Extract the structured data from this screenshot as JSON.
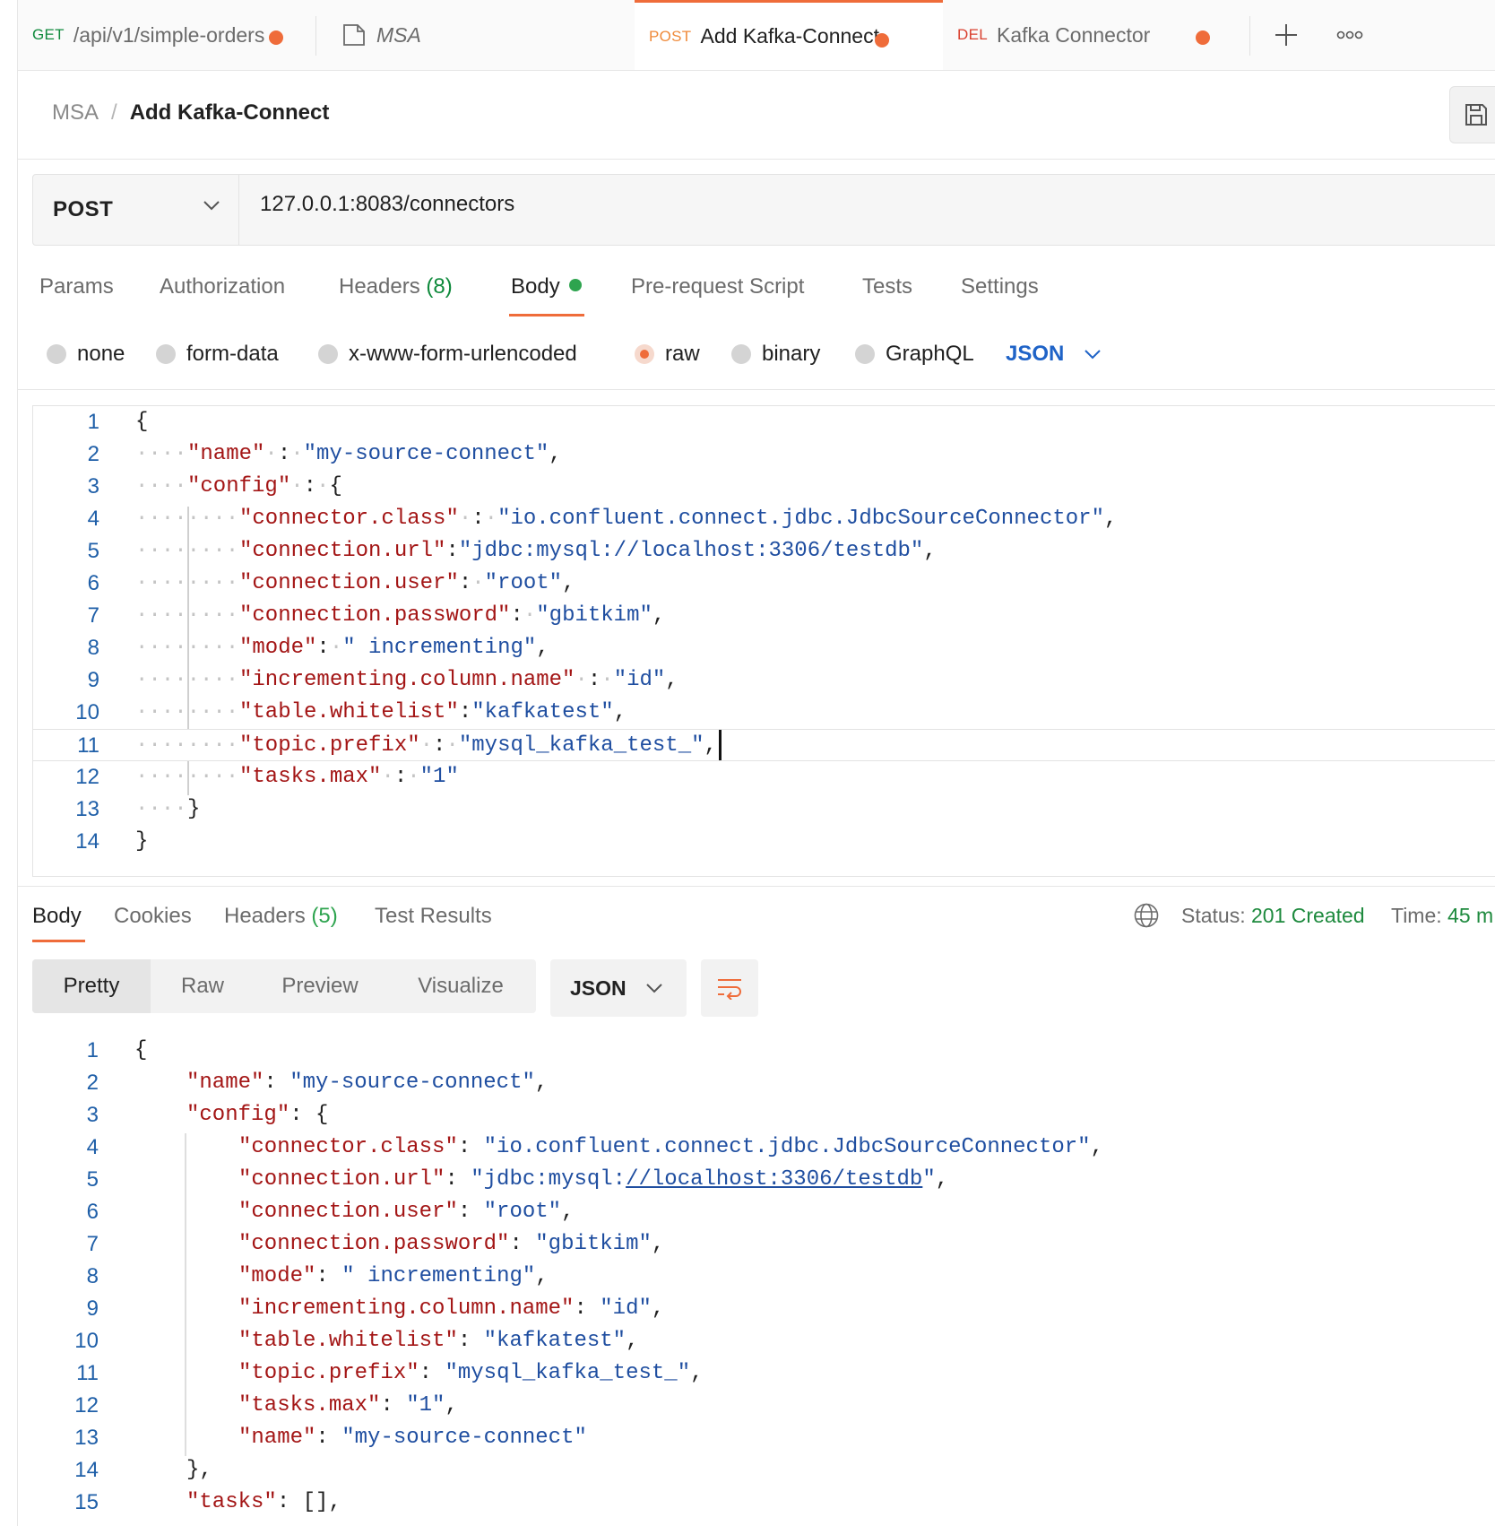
{
  "tabs": [
    {
      "method": "GET",
      "title": "/api/v1/simple-orders"
    },
    {
      "title": "MSA"
    },
    {
      "method": "POST",
      "title": "Add Kafka-Connect"
    },
    {
      "method": "DEL",
      "title": "Kafka Connector"
    }
  ],
  "breadcrumb": {
    "parent": "MSA",
    "separator": "/",
    "current": "Add Kafka-Connect"
  },
  "request": {
    "method": "POST",
    "url": "127.0.0.1:8083/connectors",
    "tabs": {
      "params": "Params",
      "authorization": "Authorization",
      "headers": "Headers",
      "headers_count": "(8)",
      "body": "Body",
      "prerequest": "Pre-request Script",
      "tests": "Tests",
      "settings": "Settings"
    },
    "body_types": [
      "none",
      "form-data",
      "x-www-form-urlencoded",
      "raw",
      "binary",
      "GraphQL"
    ],
    "selected_body_type": "raw",
    "raw_format": "JSON"
  },
  "response": {
    "tabs": {
      "body": "Body",
      "cookies": "Cookies",
      "headers": "Headers",
      "headers_count": "(5)",
      "test_results": "Test Results"
    },
    "status_label": "Status:",
    "status_value": "201 Created",
    "time_label": "Time:",
    "time_value": "45 m",
    "views": [
      "Pretty",
      "Raw",
      "Preview",
      "Visualize"
    ],
    "selected_view": "Pretty",
    "format": "JSON"
  },
  "colors": {
    "accent": "#ef6c3a",
    "get": "#0f8a3c",
    "delete": "#d9402f",
    "link": "#1f63c7",
    "success": "#1e8a3e",
    "json_key": "#a31515",
    "json_string": "#1f4ea0"
  },
  "request_body_lines": [
    {
      "n": "1",
      "text": "{"
    },
    {
      "n": "2",
      "text": "\"name\" : \"my-source-connect\","
    },
    {
      "n": "3",
      "text": "\"config\" : {"
    },
    {
      "n": "4",
      "text": "\"connector.class\" : \"io.confluent.connect.jdbc.JdbcSourceConnector\","
    },
    {
      "n": "5",
      "text": "\"connection.url\":\"jdbc:mysql://localhost:3306/testdb\","
    },
    {
      "n": "6",
      "text": "\"connection.user\": \"root\","
    },
    {
      "n": "7",
      "text": "\"connection.password\": \"gbitkim\","
    },
    {
      "n": "8",
      "text": "\"mode\": \" incrementing\","
    },
    {
      "n": "9",
      "text": "\"incrementing.column.name\" : \"id\","
    },
    {
      "n": "10",
      "text": "\"table.whitelist\":\"kafkatest\","
    },
    {
      "n": "11",
      "text": "\"topic.prefix\" : \"mysql_kafka_test_\","
    },
    {
      "n": "12",
      "text": "\"tasks.max\" : \"1\""
    },
    {
      "n": "13",
      "text": "}"
    },
    {
      "n": "14",
      "text": "}"
    }
  ],
  "response_body_lines": [
    {
      "n": "1",
      "text": "{"
    },
    {
      "n": "2",
      "text": "\"name\": \"my-source-connect\","
    },
    {
      "n": "3",
      "text": "\"config\": {"
    },
    {
      "n": "4",
      "text": "\"connector.class\": \"io.confluent.connect.jdbc.JdbcSourceConnector\","
    },
    {
      "n": "5",
      "text": "\"connection.url\": \"jdbc:mysql://localhost:3306/testdb\","
    },
    {
      "n": "6",
      "text": "\"connection.user\": \"root\","
    },
    {
      "n": "7",
      "text": "\"connection.password\": \"gbitkim\","
    },
    {
      "n": "8",
      "text": "\"mode\": \" incrementing\","
    },
    {
      "n": "9",
      "text": "\"incrementing.column.name\": \"id\","
    },
    {
      "n": "10",
      "text": "\"table.whitelist\": \"kafkatest\","
    },
    {
      "n": "11",
      "text": "\"topic.prefix\": \"mysql_kafka_test_\","
    },
    {
      "n": "12",
      "text": "\"tasks.max\": \"1\","
    },
    {
      "n": "13",
      "text": "\"name\": \"my-source-connect\""
    },
    {
      "n": "14",
      "text": "},"
    },
    {
      "n": "15",
      "text": "\"tasks\": [],"
    }
  ]
}
